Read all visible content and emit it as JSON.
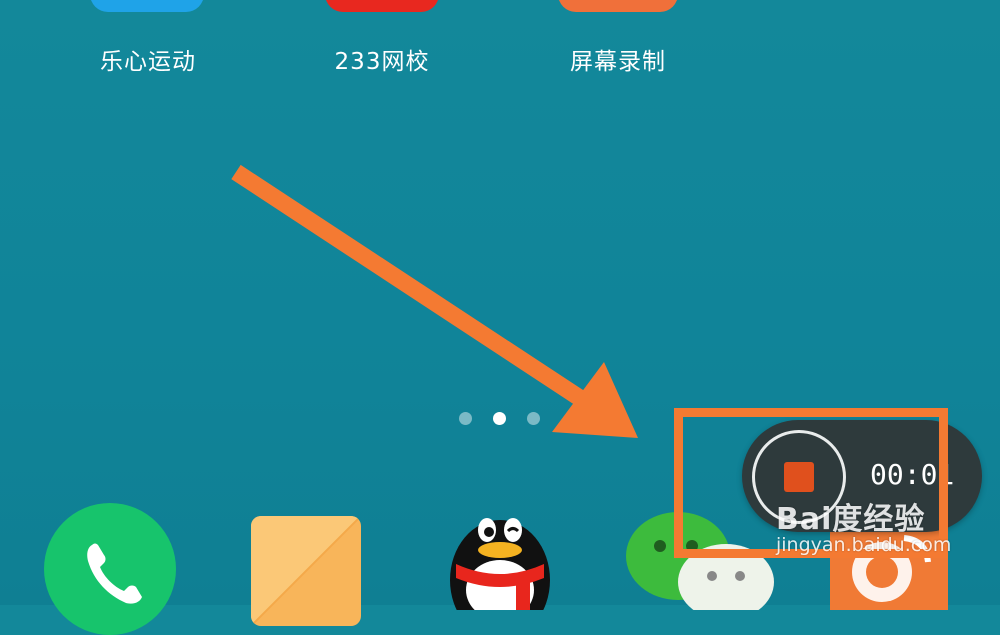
{
  "apps_top": [
    {
      "label": "乐心运动",
      "icon": "lexin-sport-app-icon",
      "color": "#1fa3e8"
    },
    {
      "label": "233网校",
      "icon": "233-school-app-icon",
      "color": "#e8281f"
    },
    {
      "label": "屏幕录制",
      "icon": "screen-recorder-app-icon",
      "color": "#f0703a"
    }
  ],
  "page_indicator": {
    "count": 3,
    "active": 2
  },
  "recording": {
    "timer": "00:01"
  },
  "annotation": {
    "color": "#f47a32"
  },
  "dock": [
    {
      "icon": "phone-icon",
      "color": "#17c46c"
    },
    {
      "icon": "notes-icon",
      "color": "#f8b55a"
    },
    {
      "icon": "qq-penguin-icon"
    },
    {
      "icon": "wechat-icon",
      "color": "#3dbb3d"
    },
    {
      "icon": "weibo-icon",
      "color": "#f07a35"
    }
  ],
  "watermark": {
    "line1": "Bai度经验",
    "line2": "jingyan.baidu.com"
  }
}
